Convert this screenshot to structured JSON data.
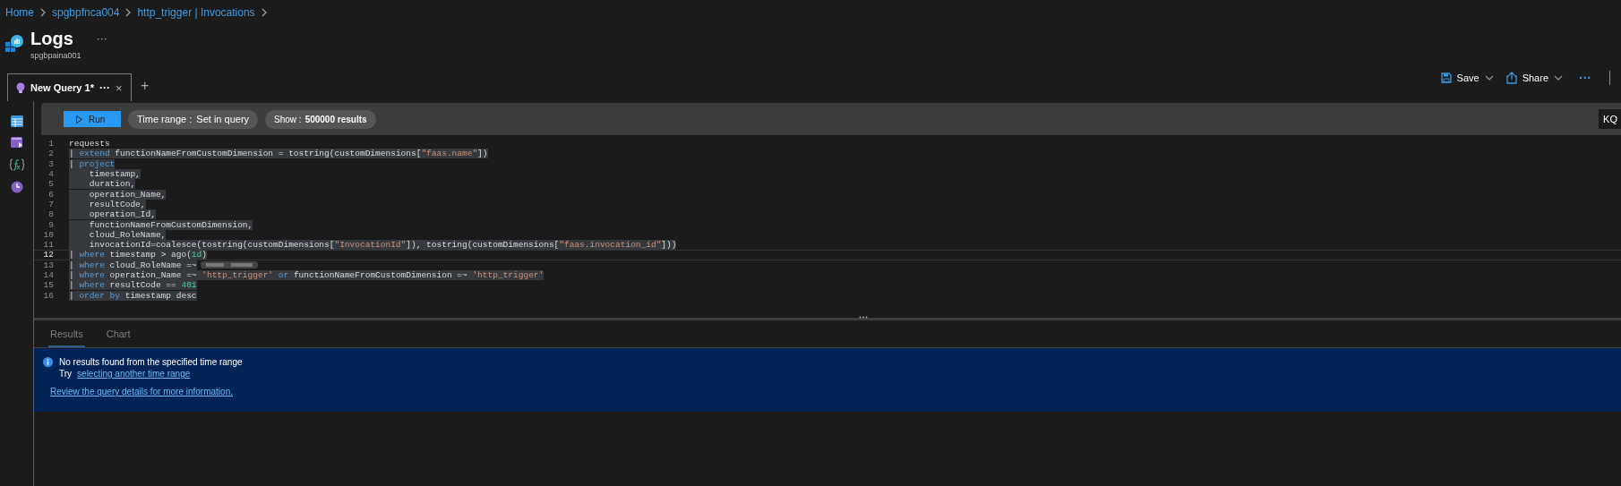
{
  "breadcrumb": [
    {
      "label": "Home"
    },
    {
      "label": "spgbpfnca004"
    },
    {
      "label": "http_trigger | Invocations"
    }
  ],
  "page": {
    "title": "Logs",
    "more": "···",
    "subtitle": "spgbpaina001"
  },
  "query_tabs": [
    {
      "label": "New Query 1*",
      "more": "···",
      "close": "×",
      "selected": true
    }
  ],
  "new_tab": "+",
  "commands": [
    {
      "kind": "save",
      "label": "Save"
    },
    {
      "kind": "share",
      "label": "Share"
    }
  ],
  "more_commands": "···",
  "sidebar": {
    "items": [
      {
        "kind": "tables"
      },
      {
        "kind": "queries"
      },
      {
        "kind": "functions"
      },
      {
        "kind": "history"
      }
    ]
  },
  "toolbar": {
    "run": "Run",
    "time_range": {
      "label": "Time range :",
      "value": "Set in query"
    },
    "show": {
      "label": "Show :",
      "value": "500000 results"
    },
    "mode": "KQ"
  },
  "editor": {
    "lines": [
      {
        "number": "1",
        "current": false,
        "highlighted": false,
        "tokens": [
          {
            "kind": "plain",
            "text": "requests"
          }
        ]
      },
      {
        "number": "2",
        "current": false,
        "highlighted": true,
        "tokens": [
          {
            "kind": "plain",
            "text": "| "
          },
          {
            "kind": "keyword",
            "text": "extend"
          },
          {
            "kind": "plain",
            "text": " functionNameFromCustomDimension = tostring(customDimensions["
          },
          {
            "kind": "string",
            "text": "\"faas.name\""
          },
          {
            "kind": "plain",
            "text": "])"
          }
        ]
      },
      {
        "number": "3",
        "current": false,
        "highlighted": true,
        "tokens": [
          {
            "kind": "plain",
            "text": "| "
          },
          {
            "kind": "keyword",
            "text": "project"
          }
        ]
      },
      {
        "number": "4",
        "current": false,
        "highlighted": true,
        "tokens": [
          {
            "kind": "plain",
            "text": "    timestamp,"
          }
        ]
      },
      {
        "number": "5",
        "current": false,
        "highlighted": true,
        "tokens": [
          {
            "kind": "plain",
            "text": "    duration,"
          }
        ]
      },
      {
        "number": "6",
        "current": false,
        "highlighted": true,
        "tokens": [
          {
            "kind": "plain",
            "text": "    operation_Name,"
          }
        ]
      },
      {
        "number": "7",
        "current": false,
        "highlighted": true,
        "tokens": [
          {
            "kind": "plain",
            "text": "    resultCode,"
          }
        ]
      },
      {
        "number": "8",
        "current": false,
        "highlighted": true,
        "tokens": [
          {
            "kind": "plain",
            "text": "    operation_Id,"
          }
        ]
      },
      {
        "number": "9",
        "current": false,
        "highlighted": true,
        "tokens": [
          {
            "kind": "plain",
            "text": "    functionNameFromCustomDimension,"
          }
        ]
      },
      {
        "number": "10",
        "current": false,
        "highlighted": true,
        "tokens": [
          {
            "kind": "plain",
            "text": "    cloud_RoleName,"
          }
        ]
      },
      {
        "number": "11",
        "current": false,
        "highlighted": true,
        "tokens": [
          {
            "kind": "plain",
            "text": "    invocationId=coalesce(tostring(customDimensions["
          },
          {
            "kind": "string",
            "text": "\"InvocationId\""
          },
          {
            "kind": "plain",
            "text": "]), tostring(customDimensions["
          },
          {
            "kind": "string",
            "text": "\"faas.invocation_id\""
          },
          {
            "kind": "plain",
            "text": "]))"
          }
        ]
      },
      {
        "number": "12",
        "current": true,
        "highlighted": true,
        "tokens": [
          {
            "kind": "plain",
            "text": "| "
          },
          {
            "kind": "keyword",
            "text": "where"
          },
          {
            "kind": "plain",
            "text": " timestamp > ago("
          },
          {
            "kind": "number",
            "text": "1d"
          },
          {
            "kind": "plain",
            "text": ")"
          }
        ]
      },
      {
        "number": "13",
        "current": false,
        "highlighted": true,
        "redacted": true,
        "tokens": [
          {
            "kind": "plain",
            "text": "| "
          },
          {
            "kind": "keyword",
            "text": "where"
          },
          {
            "kind": "plain",
            "text": " cloud_RoleName =~"
          }
        ]
      },
      {
        "number": "14",
        "current": false,
        "highlighted": true,
        "tokens": [
          {
            "kind": "plain",
            "text": "| "
          },
          {
            "kind": "keyword",
            "text": "where"
          },
          {
            "kind": "plain",
            "text": " operation_Name =~ "
          },
          {
            "kind": "string",
            "text": "'http_trigger'"
          },
          {
            "kind": "keyword",
            "text": " or"
          },
          {
            "kind": "plain",
            "text": " functionNameFromCustomDimension =~ "
          },
          {
            "kind": "string",
            "text": "'http_trigger'"
          }
        ]
      },
      {
        "number": "15",
        "current": false,
        "highlighted": true,
        "tokens": [
          {
            "kind": "plain",
            "text": "| "
          },
          {
            "kind": "keyword",
            "text": "where"
          },
          {
            "kind": "plain",
            "text": " resultCode == "
          },
          {
            "kind": "number",
            "text": "401"
          }
        ]
      },
      {
        "number": "16",
        "current": false,
        "highlighted": true,
        "tokens": [
          {
            "kind": "plain",
            "text": "| "
          },
          {
            "kind": "keyword",
            "text": "order by"
          },
          {
            "kind": "plain",
            "text": " timestamp desc"
          }
        ]
      }
    ]
  },
  "results": {
    "tabs": [
      {
        "label": "Results",
        "selected": true
      },
      {
        "label": "Chart",
        "selected": false
      }
    ],
    "message": {
      "title": "No results found from the specified time range",
      "try": "Try",
      "link": "selecting another time range",
      "details_link": "Review the query details for more information."
    }
  }
}
